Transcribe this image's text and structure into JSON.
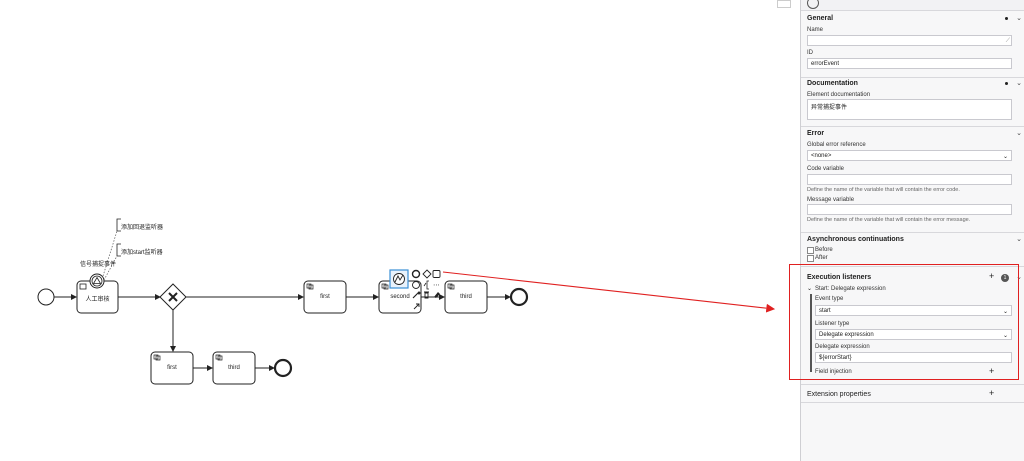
{
  "diagram": {
    "nodes": {
      "task_manual": "人工审核",
      "boundary_label": "信号捕捉事件",
      "annotation_1": "添加回退监听器",
      "annotation_2": "添加start监听器",
      "task_first_top": "first",
      "task_second": "second",
      "task_third_top": "third",
      "task_first_bottom": "first",
      "task_third_bottom": "third"
    },
    "colors": {
      "arrow": "#e02020",
      "selected": "#3a8fd6",
      "stroke": "#222222"
    }
  },
  "panel": {
    "general": {
      "title": "General",
      "name_label": "Name",
      "name_value": "",
      "id_label": "ID",
      "id_value": "errorEvent"
    },
    "documentation": {
      "title": "Documentation",
      "element_label": "Element documentation",
      "element_value": "异常捕捉事件"
    },
    "error": {
      "title": "Error",
      "global_ref_label": "Global error reference",
      "global_ref_value": "<none>",
      "code_label": "Code variable",
      "code_value": "",
      "code_hint": "Define the name of the variable that will contain the error code.",
      "message_label": "Message variable",
      "message_value": "",
      "message_hint": "Define the name of the variable that will contain the error message."
    },
    "async": {
      "title": "Asynchronous continuations",
      "before_label": "Before",
      "after_label": "After"
    },
    "listeners": {
      "title": "Execution listeners",
      "count": "1",
      "item_title": "Start: Delegate expression",
      "event_type_label": "Event type",
      "event_type_value": "start",
      "listener_type_label": "Listener type",
      "listener_type_value": "Delegate expression",
      "delegate_label": "Delegate expression",
      "delegate_value": "${errorStart}",
      "field_injection_label": "Field injection"
    },
    "extension": {
      "title": "Extension properties"
    }
  }
}
